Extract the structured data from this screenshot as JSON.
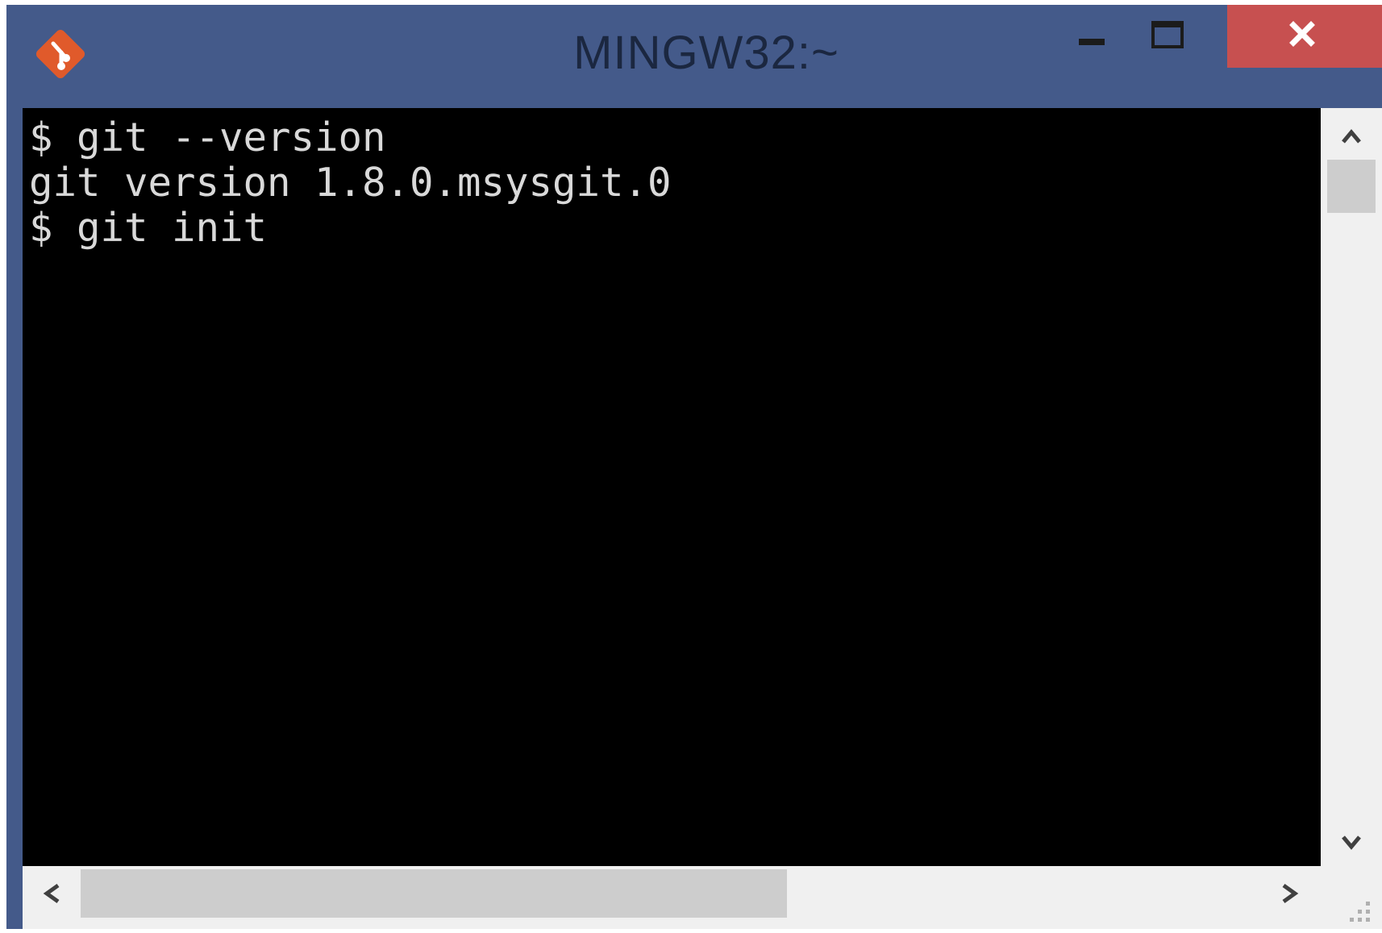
{
  "window": {
    "title": "MINGW32:~",
    "accent_color": "#445a8a",
    "close_color": "#c75050",
    "app_icon": "git-logo-icon"
  },
  "controls": {
    "minimize_icon": "minimize-icon",
    "maximize_icon": "maximize-icon",
    "close_icon": "close-icon"
  },
  "terminal": {
    "background": "#000000",
    "text_color": "#d9d9d9",
    "lines": [
      "$ git --version",
      "git version 1.8.0.msysgit.0",
      "$ git init"
    ]
  },
  "scrollbars": {
    "up_icon": "chevron-up-icon",
    "down_icon": "chevron-down-icon",
    "left_icon": "chevron-left-icon",
    "right_icon": "chevron-right-icon",
    "grip_icon": "resize-grip-icon"
  }
}
